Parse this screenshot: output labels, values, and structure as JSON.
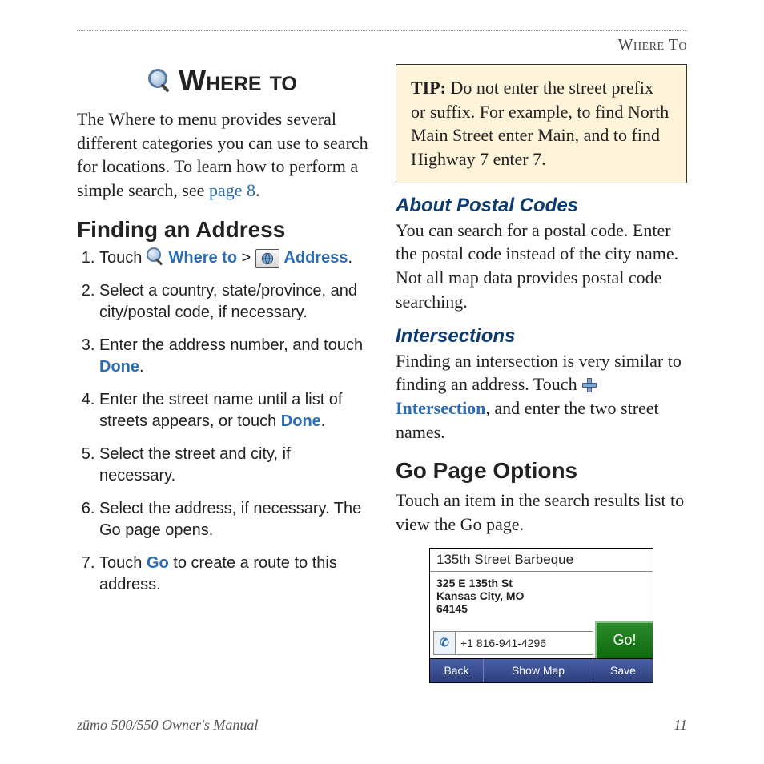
{
  "header": {
    "section": "Where To"
  },
  "chapter_title": "Where to",
  "intro": {
    "text_a": "The Where to menu provides several different categories you can use to search for locations. To learn how to perform a simple search, see ",
    "link": "page 8",
    "text_b": "."
  },
  "finding": {
    "heading": "Finding an Address",
    "steps": {
      "s1_a": "Touch ",
      "s1_where": "Where to",
      "s1_sep": " > ",
      "s1_addr": "Address",
      "s1_end": ".",
      "s2": "Select a country, state/province, and city/postal code, if necessary.",
      "s3_a": "Enter the address number, and touch ",
      "s3_done": "Done",
      "s3_end": ".",
      "s4_a": "Enter the street name until a list of streets appears, or touch ",
      "s4_done": "Done",
      "s4_end": ".",
      "s5": "Select the street and city, if necessary.",
      "s6": "Select the address, if necessary. The Go page opens.",
      "s7_a": "Touch ",
      "s7_go": "Go",
      "s7_b": " to create a route to this address."
    }
  },
  "tip": {
    "label": "TIP:",
    "text": "  Do not enter the street prefix or suffix. For example, to find North Main Street enter Main, and to find Highway 7 enter 7."
  },
  "postal": {
    "heading": "About Postal Codes",
    "body": "You can search for a postal code. Enter the postal code instead of the city name. Not all map data provides postal code searching."
  },
  "intersections": {
    "heading": "Intersections",
    "body_a": "Finding an intersection is very similar to finding an address. Touch ",
    "link": "Intersection",
    "body_b": ", and enter the two street names."
  },
  "gopage": {
    "heading": "Go Page Options",
    "body": "Touch an item in the search results list to view the Go page."
  },
  "device": {
    "title": "135th Street Barbeque",
    "addr1": "325 E 135th St",
    "addr2": "Kansas City, MO",
    "addr3": "64145",
    "phone": "+1 816-941-4296",
    "go": "Go!",
    "back": "Back",
    "showmap": "Show Map",
    "save": "Save"
  },
  "footer": {
    "left": "zūmo 500/550 Owner's Manual",
    "right": "11"
  }
}
